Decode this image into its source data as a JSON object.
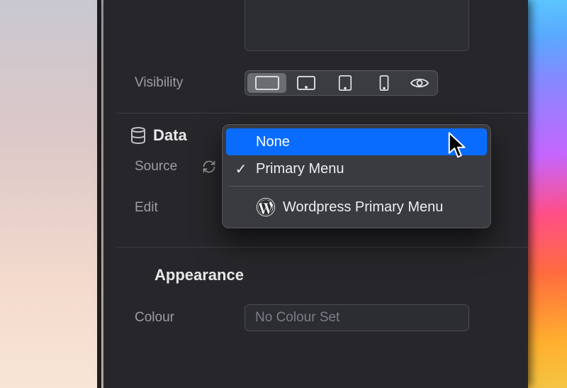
{
  "visibility_label": "Visibility",
  "data_section": "Data",
  "source_label": "Source",
  "edit_label": "Edit",
  "appearance_section": "Appearance",
  "colour_label": "Colour",
  "colour_placeholder": "No Colour Set",
  "dropdown": {
    "none": "None",
    "primary": "Primary Menu",
    "wordpress": "Wordpress Primary Menu"
  },
  "icons": {
    "database": "database-icon",
    "refresh": "refresh-icon",
    "desktop": "desktop-device-icon",
    "tablet_landscape": "tablet-landscape-icon",
    "tablet_portrait": "tablet-portrait-icon",
    "phone": "phone-device-icon",
    "eye": "preview-eye-icon",
    "wordpress": "wordpress-icon",
    "check": "checkmark-icon",
    "cursor": "mouse-cursor"
  }
}
